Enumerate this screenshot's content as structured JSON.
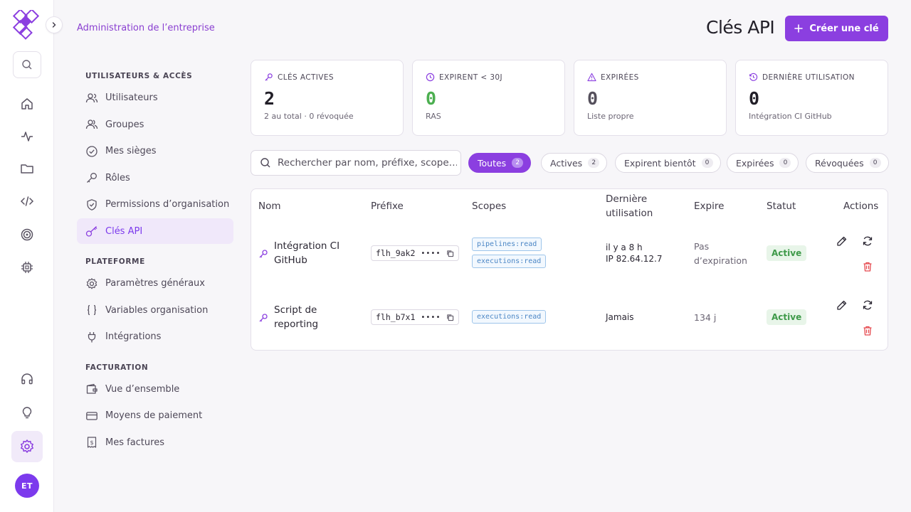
{
  "app": {
    "breadcrumb": "Administration de l’entreprise",
    "avatar_initials": "ET",
    "accent_color": "#8b3fe0"
  },
  "header": {
    "title": "Clés API",
    "create_label": "Créer une clé"
  },
  "sidenav": {
    "sections": [
      {
        "title": "UTILISATEURS & ACCÈS",
        "items": [
          "Utilisateurs",
          "Groupes",
          "Mes sièges",
          "Rôles",
          "Permissions d’organisation",
          "Clés API"
        ]
      },
      {
        "title": "PLATEFORME",
        "items": [
          "Paramètres généraux",
          "Variables organisation",
          "Intégrations"
        ]
      },
      {
        "title": "FACTURATION",
        "items": [
          "Vue d’ensemble",
          "Moyens de paiement",
          "Mes factures"
        ]
      }
    ],
    "active_item": "Clés API"
  },
  "stats": [
    {
      "label": "CLÉS ACTIVES",
      "value": "2",
      "sub": "2 au total · 0 révoquée",
      "icon": "key-icon"
    },
    {
      "label": "EXPIRENT < 30J",
      "value": "0",
      "sub": "RAS",
      "icon": "clock-icon"
    },
    {
      "label": "EXPIRÉES",
      "value": "0",
      "sub": "Liste propre",
      "icon": "warning-icon"
    },
    {
      "label": "DERNIÈRE UTILISATION",
      "value": "0",
      "sub": "Intégration CI GitHub",
      "icon": "history-icon"
    }
  ],
  "search": {
    "placeholder": "Rechercher par nom, préfixe, scope…"
  },
  "filters": [
    {
      "label": "Toutes",
      "count": "2",
      "active": true
    },
    {
      "label": "Actives",
      "count": "2"
    },
    {
      "label": "Expirent bientôt",
      "count": "0"
    },
    {
      "label": "Expirées",
      "count": "0"
    },
    {
      "label": "Révoquées",
      "count": "0"
    }
  ],
  "table": {
    "columns": {
      "name": "Nom",
      "prefix": "Préfixe",
      "scopes": "Scopes",
      "last_used_1": "Dernière",
      "last_used_2": "utilisation",
      "expires": "Expire",
      "status": "Statut",
      "actions": "Actions"
    },
    "rows": [
      {
        "name_1": "Intégration CI",
        "name_2": "GitHub",
        "prefix": "flh_9ak2",
        "mask": "••••",
        "scopes": [
          "pipelines:read",
          "executions:read"
        ],
        "last_used": "il y a 8 h",
        "ip": "IP 82.64.12.7",
        "expires_1": "Pas",
        "expires_2": "d’expiration",
        "status": "Active"
      },
      {
        "name_1": "Script de",
        "name_2": "reporting",
        "prefix": "flh_b7x1",
        "mask": "••••",
        "scopes": [
          "executions:read"
        ],
        "last_used": "Jamais",
        "expires": "134 j",
        "status": "Active"
      }
    ]
  }
}
